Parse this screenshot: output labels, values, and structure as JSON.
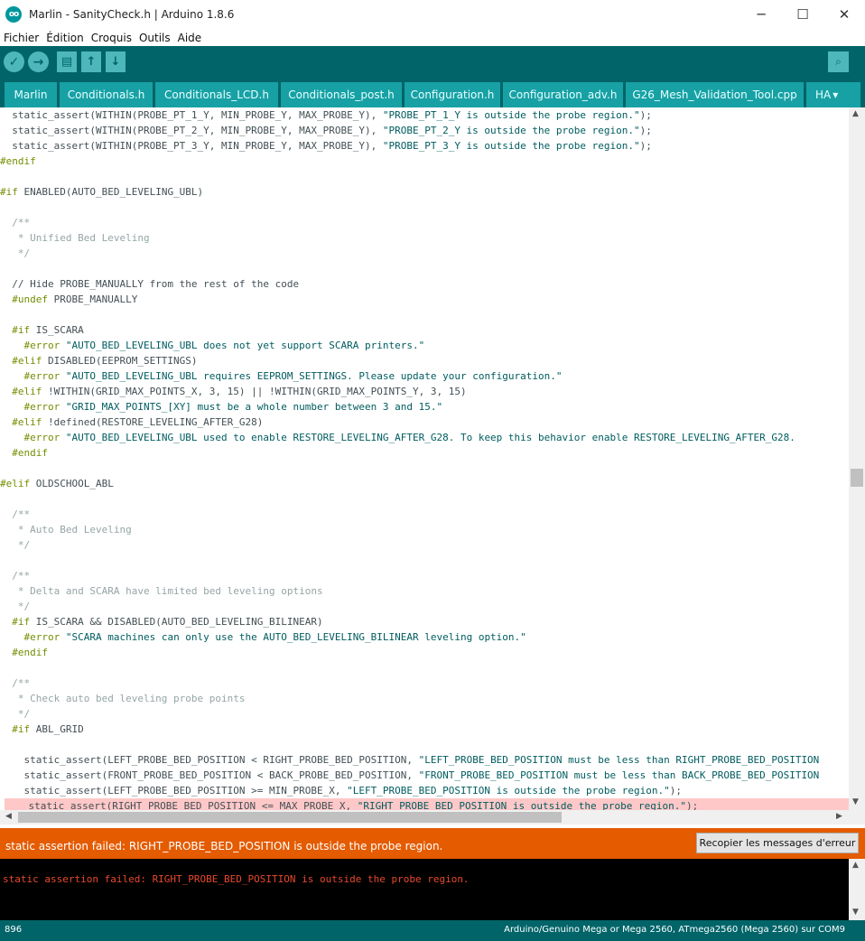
{
  "window": {
    "title": "Marlin - SanityCheck.h | Arduino 1.8.6",
    "icon_text": "oo"
  },
  "window_controls": {
    "minimize": "─",
    "maximize": "☐",
    "close": "✕"
  },
  "menu": [
    "Fichier",
    "Édition",
    "Croquis",
    "Outils",
    "Aide"
  ],
  "toolbar": {
    "verify_icon": "✓",
    "upload_icon": "→",
    "new_icon": "▤",
    "open_icon": "↑",
    "save_icon": "↓",
    "serial_icon": "⌕"
  },
  "tabs": [
    "Marlin",
    "Conditionals.h",
    "Conditionals_LCD.h",
    "Conditionals_post.h",
    "Configuration.h",
    "Configuration_adv.h",
    "G26_Mesh_Validation_Tool.cpp",
    "HA"
  ],
  "tab_menu_icon": "▾",
  "code": [
    [
      [
        "  static_assert(WITHIN(PROBE_PT_1_Y, MIN_PROBE_Y, MAX_PROBE_Y), ",
        "n"
      ],
      [
        "\"PROBE_PT_1_Y is outside the probe region.\"",
        "s"
      ],
      [
        ");",
        "n"
      ]
    ],
    [
      [
        "  static_assert(WITHIN(PROBE_PT_2_Y, MIN_PROBE_Y, MAX_PROBE_Y), ",
        "n"
      ],
      [
        "\"PROBE_PT_2_Y is outside the probe region.\"",
        "s"
      ],
      [
        ");",
        "n"
      ]
    ],
    [
      [
        "  static_assert(WITHIN(PROBE_PT_3_Y, MIN_PROBE_Y, MAX_PROBE_Y), ",
        "n"
      ],
      [
        "\"PROBE_PT_3_Y is outside the probe region.\"",
        "s"
      ],
      [
        ");",
        "n"
      ]
    ],
    [
      [
        "#endif",
        "p"
      ]
    ],
    [],
    [
      [
        "#if",
        "p"
      ],
      [
        " ENABLED(AUTO_BED_LEVELING_UBL)",
        "n"
      ]
    ],
    [],
    [
      [
        "  /**",
        "c"
      ]
    ],
    [
      [
        "   * Unified Bed Leveling",
        "c"
      ]
    ],
    [
      [
        "   */",
        "c"
      ]
    ],
    [],
    [
      [
        "  // Hide PROBE_MANUALLY from the rest of the code",
        "n"
      ]
    ],
    [
      [
        "  #undef",
        "p"
      ],
      [
        " PROBE_MANUALLY",
        "n"
      ]
    ],
    [],
    [
      [
        "  #if",
        "p"
      ],
      [
        " IS_SCARA",
        "n"
      ]
    ],
    [
      [
        "    #error",
        "p"
      ],
      [
        " ",
        "n"
      ],
      [
        "\"AUTO_BED_LEVELING_UBL does not yet support SCARA printers.\"",
        "s"
      ]
    ],
    [
      [
        "  #elif",
        "p"
      ],
      [
        " DISABLED(EEPROM_SETTINGS)",
        "n"
      ]
    ],
    [
      [
        "    #error",
        "p"
      ],
      [
        " ",
        "n"
      ],
      [
        "\"AUTO_BED_LEVELING_UBL requires EEPROM_SETTINGS. Please update your configuration.\"",
        "s"
      ]
    ],
    [
      [
        "  #elif",
        "p"
      ],
      [
        " !WITHIN(GRID_MAX_POINTS_X, 3, 15) || !WITHIN(GRID_MAX_POINTS_Y, 3, 15)",
        "n"
      ]
    ],
    [
      [
        "    #error",
        "p"
      ],
      [
        " ",
        "n"
      ],
      [
        "\"GRID_MAX_POINTS_[XY] must be a whole number between 3 and 15.\"",
        "s"
      ]
    ],
    [
      [
        "  #elif",
        "p"
      ],
      [
        " !defined(RESTORE_LEVELING_AFTER_G28)",
        "n"
      ]
    ],
    [
      [
        "    #error",
        "p"
      ],
      [
        " ",
        "n"
      ],
      [
        "\"AUTO_BED_LEVELING_UBL used to enable RESTORE_LEVELING_AFTER_G28. To keep this behavior enable RESTORE_LEVELING_AFTER_G28.",
        "s"
      ]
    ],
    [
      [
        "  #endif",
        "p"
      ]
    ],
    [],
    [
      [
        "#elif",
        "p"
      ],
      [
        " OLDSCHOOL_ABL",
        "n"
      ]
    ],
    [],
    [
      [
        "  /**",
        "c"
      ]
    ],
    [
      [
        "   * Auto Bed Leveling",
        "c"
      ]
    ],
    [
      [
        "   */",
        "c"
      ]
    ],
    [],
    [
      [
        "  /**",
        "c"
      ]
    ],
    [
      [
        "   * Delta and SCARA have limited bed leveling options",
        "c"
      ]
    ],
    [
      [
        "   */",
        "c"
      ]
    ],
    [
      [
        "  #if",
        "p"
      ],
      [
        " IS_SCARA && DISABLED(AUTO_BED_LEVELING_BILINEAR)",
        "n"
      ]
    ],
    [
      [
        "    #error",
        "p"
      ],
      [
        " ",
        "n"
      ],
      [
        "\"SCARA machines can only use the AUTO_BED_LEVELING_BILINEAR leveling option.\"",
        "s"
      ]
    ],
    [
      [
        "  #endif",
        "p"
      ]
    ],
    [],
    [
      [
        "  /**",
        "c"
      ]
    ],
    [
      [
        "   * Check auto bed leveling probe points",
        "c"
      ]
    ],
    [
      [
        "   */",
        "c"
      ]
    ],
    [
      [
        "  #if",
        "p"
      ],
      [
        " ABL_GRID",
        "n"
      ]
    ],
    [],
    [
      [
        "    static_assert(LEFT_PROBE_BED_POSITION < RIGHT_PROBE_BED_POSITION, ",
        "n"
      ],
      [
        "\"LEFT_PROBE_BED_POSITION must be less than RIGHT_PROBE_BED_POSITION",
        "s"
      ]
    ],
    [
      [
        "    static_assert(FRONT_PROBE_BED_POSITION < BACK_PROBE_BED_POSITION, ",
        "n"
      ],
      [
        "\"FRONT_PROBE_BED_POSITION must be less than BACK_PROBE_BED_POSITION",
        "s"
      ]
    ],
    [
      [
        "    static_assert(LEFT_PROBE_BED_POSITION >= MIN_PROBE_X, ",
        "n"
      ],
      [
        "\"LEFT_PROBE_BED_POSITION is outside the probe region.\"",
        "s"
      ],
      [
        ");",
        "n"
      ]
    ],
    [
      [
        "    static_assert(RIGHT_PROBE_BED_POSITION <= MAX_PROBE_X, ",
        "n"
      ],
      [
        "\"RIGHT_PROBE_BED_POSITION is outside the probe region.\"",
        "s"
      ],
      [
        ");",
        "n"
      ]
    ]
  ],
  "error_line_index": 45,
  "status": {
    "message": "static assertion failed: RIGHT_PROBE_BED_POSITION is outside the probe region.",
    "copy_button": "Recopier les messages d'erreur"
  },
  "console": {
    "text": "static assertion failed: RIGHT_PROBE_BED_POSITION is outside the probe region."
  },
  "footer": {
    "line_number": "896",
    "board": "Arduino/Genuino Mega or Mega 2560, ATmega2560 (Mega 2560) sur COM9"
  },
  "colors": {
    "teal_dark": "#006468",
    "teal_tab": "#17a1a5",
    "error_orange": "#e45b00",
    "error_line": "#ffc8c8"
  }
}
